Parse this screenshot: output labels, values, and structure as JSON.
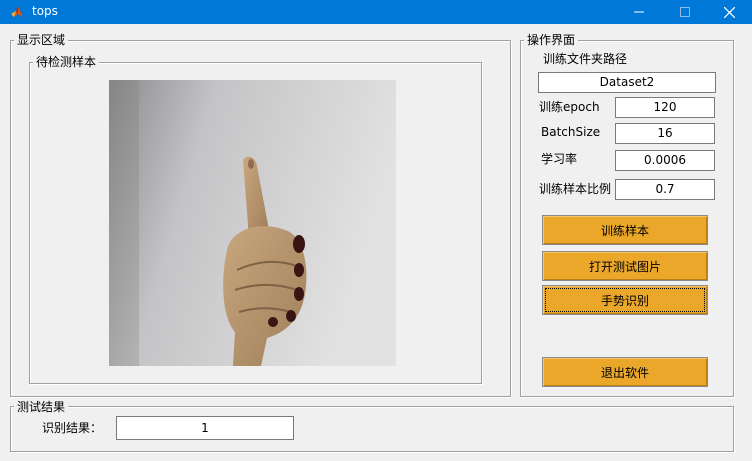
{
  "window": {
    "title": "tops"
  },
  "display_panel": {
    "title": "显示区域",
    "sample_panel": {
      "title": "待检测样本"
    }
  },
  "ops_panel": {
    "title": "操作界面",
    "folder_label": "训练文件夹路径",
    "folder_value": "Dataset2",
    "epoch_label": "训练epoch",
    "epoch_value": "120",
    "batch_label": "BatchSize",
    "batch_value": "16",
    "lr_label": "学习率",
    "lr_value": "0.0006",
    "ratio_label": "训练样本比例",
    "ratio_value": "0.7",
    "buttons": {
      "train": "训练样本",
      "open_image": "打开测试图片",
      "recognize": "手势识别",
      "exit": "退出软件"
    }
  },
  "result_panel": {
    "title": "测试结果",
    "label": "识别结果：",
    "value": "1"
  },
  "colors": {
    "titlebar": "#0078d7",
    "button": "#eaa72a",
    "background": "#f0f0f0"
  },
  "icons": [
    "matlab-icon",
    "minimize-icon",
    "maximize-icon",
    "close-icon",
    "hand-gesture-photo"
  ]
}
